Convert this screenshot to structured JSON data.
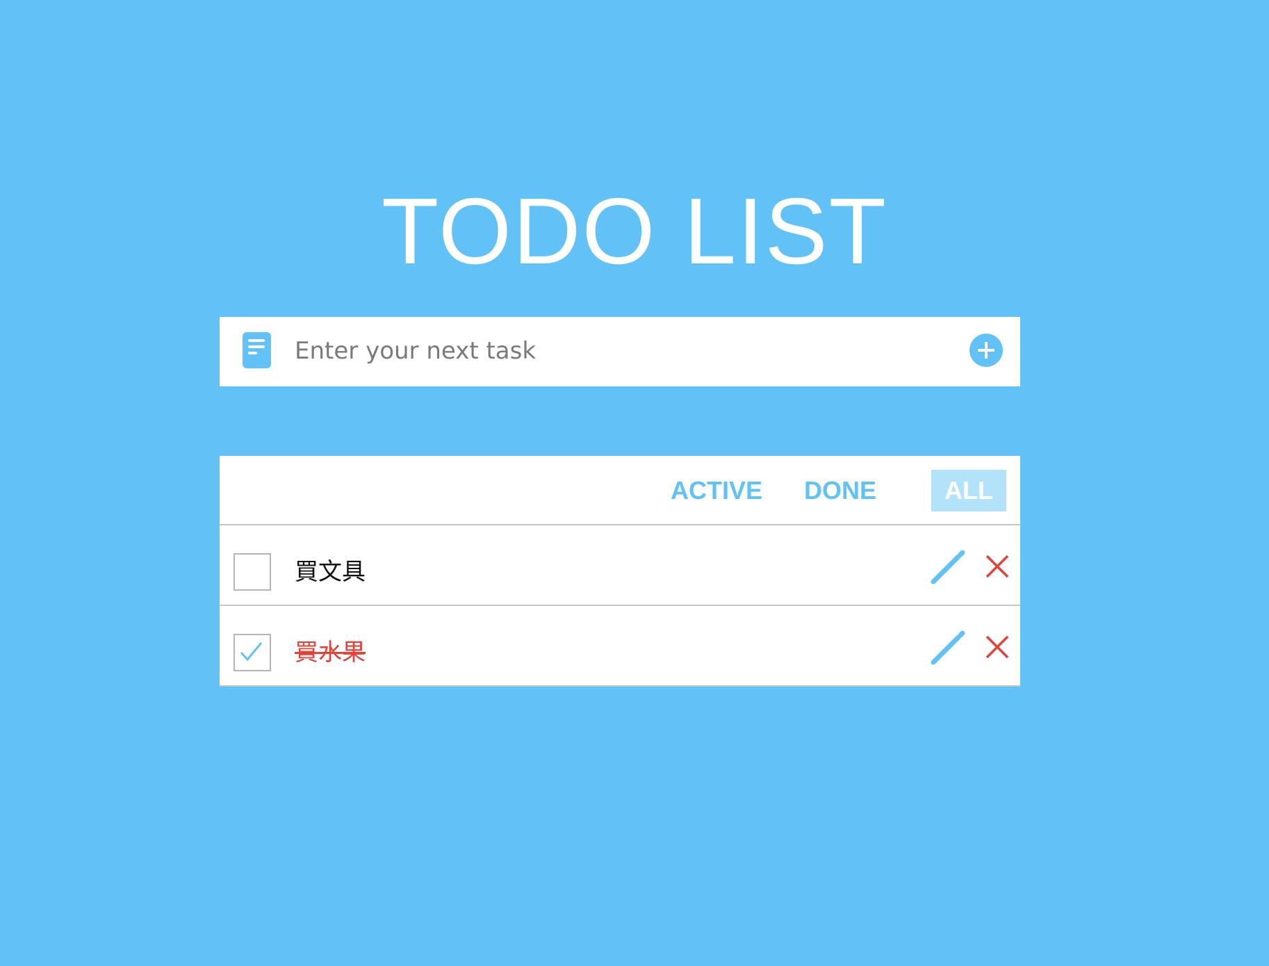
{
  "header": {
    "title": "TODO LIST"
  },
  "new_task": {
    "placeholder": "Enter your next task",
    "value": "",
    "icon": "document-icon",
    "add_icon": "plus-circle-icon"
  },
  "filters": {
    "active_label": "ACTIVE",
    "done_label": "DONE",
    "all_label": "ALL",
    "selected": "ALL"
  },
  "todos": [
    {
      "text": "買文具",
      "done": false,
      "edit_icon": "pencil-icon",
      "delete_icon": "close-icon"
    },
    {
      "text": "買水果",
      "done": true,
      "edit_icon": "pencil-icon",
      "delete_icon": "close-icon"
    }
  ],
  "colors": {
    "background": "#63c2f5",
    "accent": "#63c2f5",
    "selected_filter_bg": "#b3e2fb",
    "delete": "#e0433a",
    "done_text": "#e0433a",
    "divider": "#c7c7c7"
  }
}
